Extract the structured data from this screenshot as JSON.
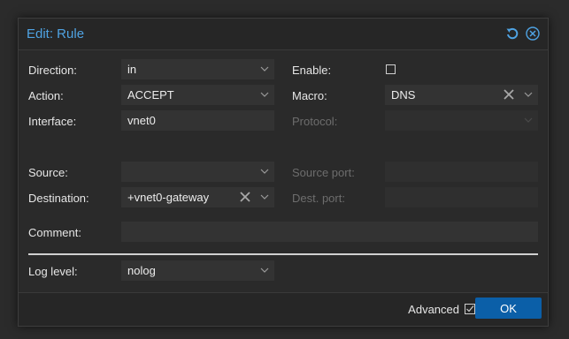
{
  "dialog": {
    "title": "Edit: Rule"
  },
  "form": {
    "direction": {
      "label": "Direction:",
      "value": "in"
    },
    "action": {
      "label": "Action:",
      "value": "ACCEPT"
    },
    "interface": {
      "label": "Interface:",
      "value": "vnet0"
    },
    "source": {
      "label": "Source:",
      "value": ""
    },
    "destination": {
      "label": "Destination:",
      "value": "+vnet0-gateway"
    },
    "comment": {
      "label": "Comment:",
      "value": ""
    },
    "log_level": {
      "label": "Log level:",
      "value": "nolog"
    },
    "enable": {
      "label": "Enable:",
      "checked": false
    },
    "macro": {
      "label": "Macro:",
      "value": "DNS"
    },
    "protocol": {
      "label": "Protocol:",
      "value": "",
      "disabled": true
    },
    "source_port": {
      "label": "Source port:",
      "value": "",
      "disabled": true
    },
    "dest_port": {
      "label": "Dest. port:",
      "value": "",
      "disabled": true
    }
  },
  "footer": {
    "advanced_label": "Advanced",
    "advanced_checked": true,
    "ok_label": "OK"
  },
  "colors": {
    "accent": "#4fa3e3",
    "primary_button": "#0b5fa8"
  }
}
